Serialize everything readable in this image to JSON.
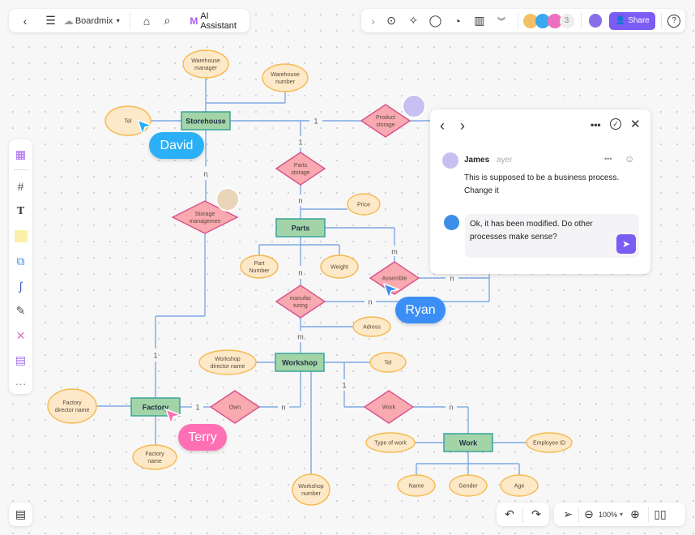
{
  "toolbar_left": {
    "app_name": "Boardmix",
    "ai_label": "AI Assistant",
    "icons": [
      "back-icon",
      "menu-icon",
      "cloud-icon",
      "tag-icon",
      "search-icon"
    ]
  },
  "toolbar_right": {
    "collaborator_count": "3",
    "share_label": "Share",
    "icons": [
      "expand-icon",
      "present-icon",
      "celebrate-icon",
      "comment-icon",
      "timer-icon",
      "vote-icon",
      "more-icon",
      "help-icon"
    ]
  },
  "diagram": {
    "entities": {
      "storehouse": "Storehouse",
      "parts": "Parts",
      "workshop": "Workshop",
      "factory": "Factory",
      "work": "Work"
    },
    "relations": {
      "product_storage": [
        "Product",
        "storage"
      ],
      "parts_storage": [
        "Parts",
        "storage"
      ],
      "storage_management": [
        "Storage",
        "managemen"
      ],
      "assemble": [
        "Assemble"
      ],
      "manufacturing": [
        "manufac",
        "turing"
      ],
      "own": [
        "Own"
      ],
      "work_rel": [
        "Work"
      ]
    },
    "attributes": {
      "warehouse_manager": [
        "Warehouse",
        "manager"
      ],
      "warehouse_number": [
        "Warehouse",
        "number"
      ],
      "tel": [
        "Tel"
      ],
      "price": [
        "Price"
      ],
      "part_number": [
        "Part",
        "Number"
      ],
      "weight": [
        "Weight"
      ],
      "adress": [
        "Adress"
      ],
      "workshop_director": [
        "Workshop",
        "director name"
      ],
      "tel2": [
        "Tel"
      ],
      "factory_director": [
        "Factory",
        "director name"
      ],
      "factory_name": [
        "Factory",
        "name"
      ],
      "workshop_number": [
        "Workshop",
        "number"
      ],
      "type_of_work": [
        "Type of work"
      ],
      "employee_id": [
        "Employee ID"
      ],
      "name": [
        "Name"
      ],
      "gender": [
        "Gender"
      ],
      "age": [
        "Age"
      ]
    },
    "cardinalities": {
      "c1": "1",
      "c2": "1",
      "c3": "n",
      "c4": "n",
      "c5": "m",
      "c6": "n",
      "c7": "n",
      "c8": "n",
      "c9": "m",
      "c10": "1",
      "c11": "1",
      "c12": "n",
      "c13": "1",
      "c14": "n"
    },
    "colors": {
      "entity": "#a3d4a8",
      "relation": "#f9a9b0",
      "attribute": "#fde8c8",
      "line": "#7fa9e4"
    }
  },
  "cursors": {
    "david": "David",
    "ryan": "Ryan",
    "terry": "Terry",
    "colors": {
      "david": "#2bb0f7",
      "ryan": "#3b8ef6",
      "terry": "#ff6fb3"
    }
  },
  "comment": {
    "author": "James",
    "time": "ayer",
    "text": "This is supposed to be a business process. Change it",
    "reply": "Ok, it has been modified. Do other processes make sense?"
  },
  "left_tools": [
    "templates-icon",
    "frame-icon",
    "text-icon",
    "sticky-note-icon",
    "shape-icon",
    "connector-icon",
    "pen-icon",
    "mindmap-icon",
    "table-icon",
    "more-icon"
  ],
  "bottom": {
    "zoom": "100%"
  },
  "accent": "#7b5cf5"
}
